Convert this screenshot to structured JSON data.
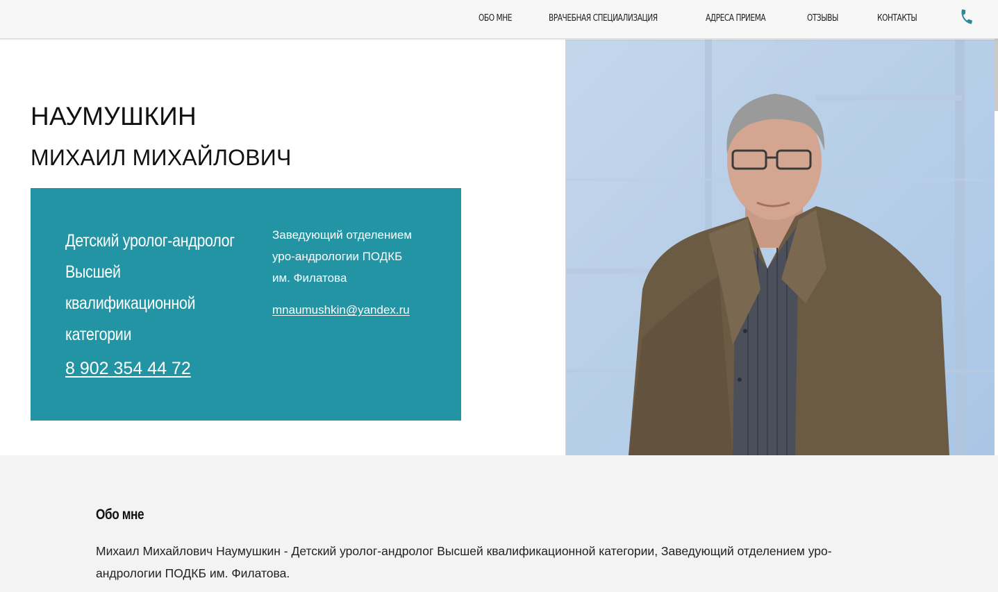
{
  "nav": {
    "items": [
      {
        "label": "ОБО МНЕ"
      },
      {
        "label": "ВРАЧЕБНАЯ СПЕЦИАЛИЗАЦИЯ"
      },
      {
        "label": "АДРЕСА ПРИЕМА"
      },
      {
        "label": "ОТЗЫВЫ"
      },
      {
        "label": "КОНТАКТЫ"
      }
    ],
    "phone_icon": "phone-icon"
  },
  "hero": {
    "surname": "НАУМУШКИН",
    "name": "МИХАИЛ МИХАЙЛОВИЧ",
    "card": {
      "specialty_lines": [
        "Детский уролог-андролог",
        "Высшей",
        "квалификационной",
        "категории"
      ],
      "phone": "8 902 354 44 72",
      "position_lines": [
        "Заведующий отделением",
        "уро-андрологии ПОДКБ",
        "им. Филатова"
      ],
      "email": "mnaumushkin@yandex.ru"
    }
  },
  "about": {
    "title": "Обо мне",
    "text": "Михаил Михайлович Наумушкин - Детский уролог-андролог Высшей квалификационной категории, Заведующий отделением уро-андрологии ПОДКБ им. Филатова."
  },
  "colors": {
    "accent": "#2294a4",
    "phone_icon": "#2a8a98"
  }
}
